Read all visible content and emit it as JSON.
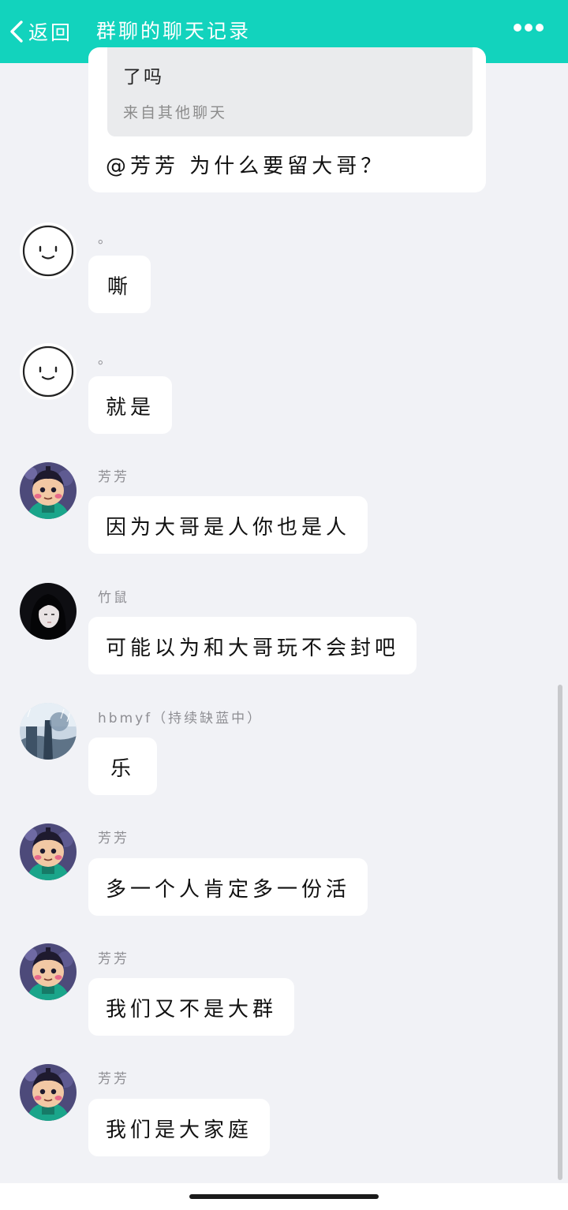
{
  "header": {
    "back_label": "返回",
    "title": "群聊的聊天记录",
    "more_icon": "more-dots-icon",
    "color": "#12d3bd"
  },
  "quote": {
    "text": "了吗",
    "source": "来自其他聊天",
    "reply": "@芳芳 为什么要留大哥？"
  },
  "messages": [
    {
      "sender": "。",
      "avatar": "smiley-face",
      "text": "嘶"
    },
    {
      "sender": "。",
      "avatar": "smiley-face",
      "text": "就是"
    },
    {
      "sender": "芳芳",
      "avatar": "cartoon-boy",
      "text": "因为大哥是人你也是人"
    },
    {
      "sender": "竹鼠",
      "avatar": "dark-hair-girl",
      "text": "可能以为和大哥玩不会封吧"
    },
    {
      "sender": "hbmyf（持续缺蓝中）",
      "avatar": "rainy-scene",
      "text": "乐"
    },
    {
      "sender": "芳芳",
      "avatar": "cartoon-boy",
      "text": "多一个人肯定多一份活"
    },
    {
      "sender": "芳芳",
      "avatar": "cartoon-boy",
      "text": "我们又不是大群"
    },
    {
      "sender": "芳芳",
      "avatar": "cartoon-boy",
      "text": "我们是大家庭"
    }
  ]
}
